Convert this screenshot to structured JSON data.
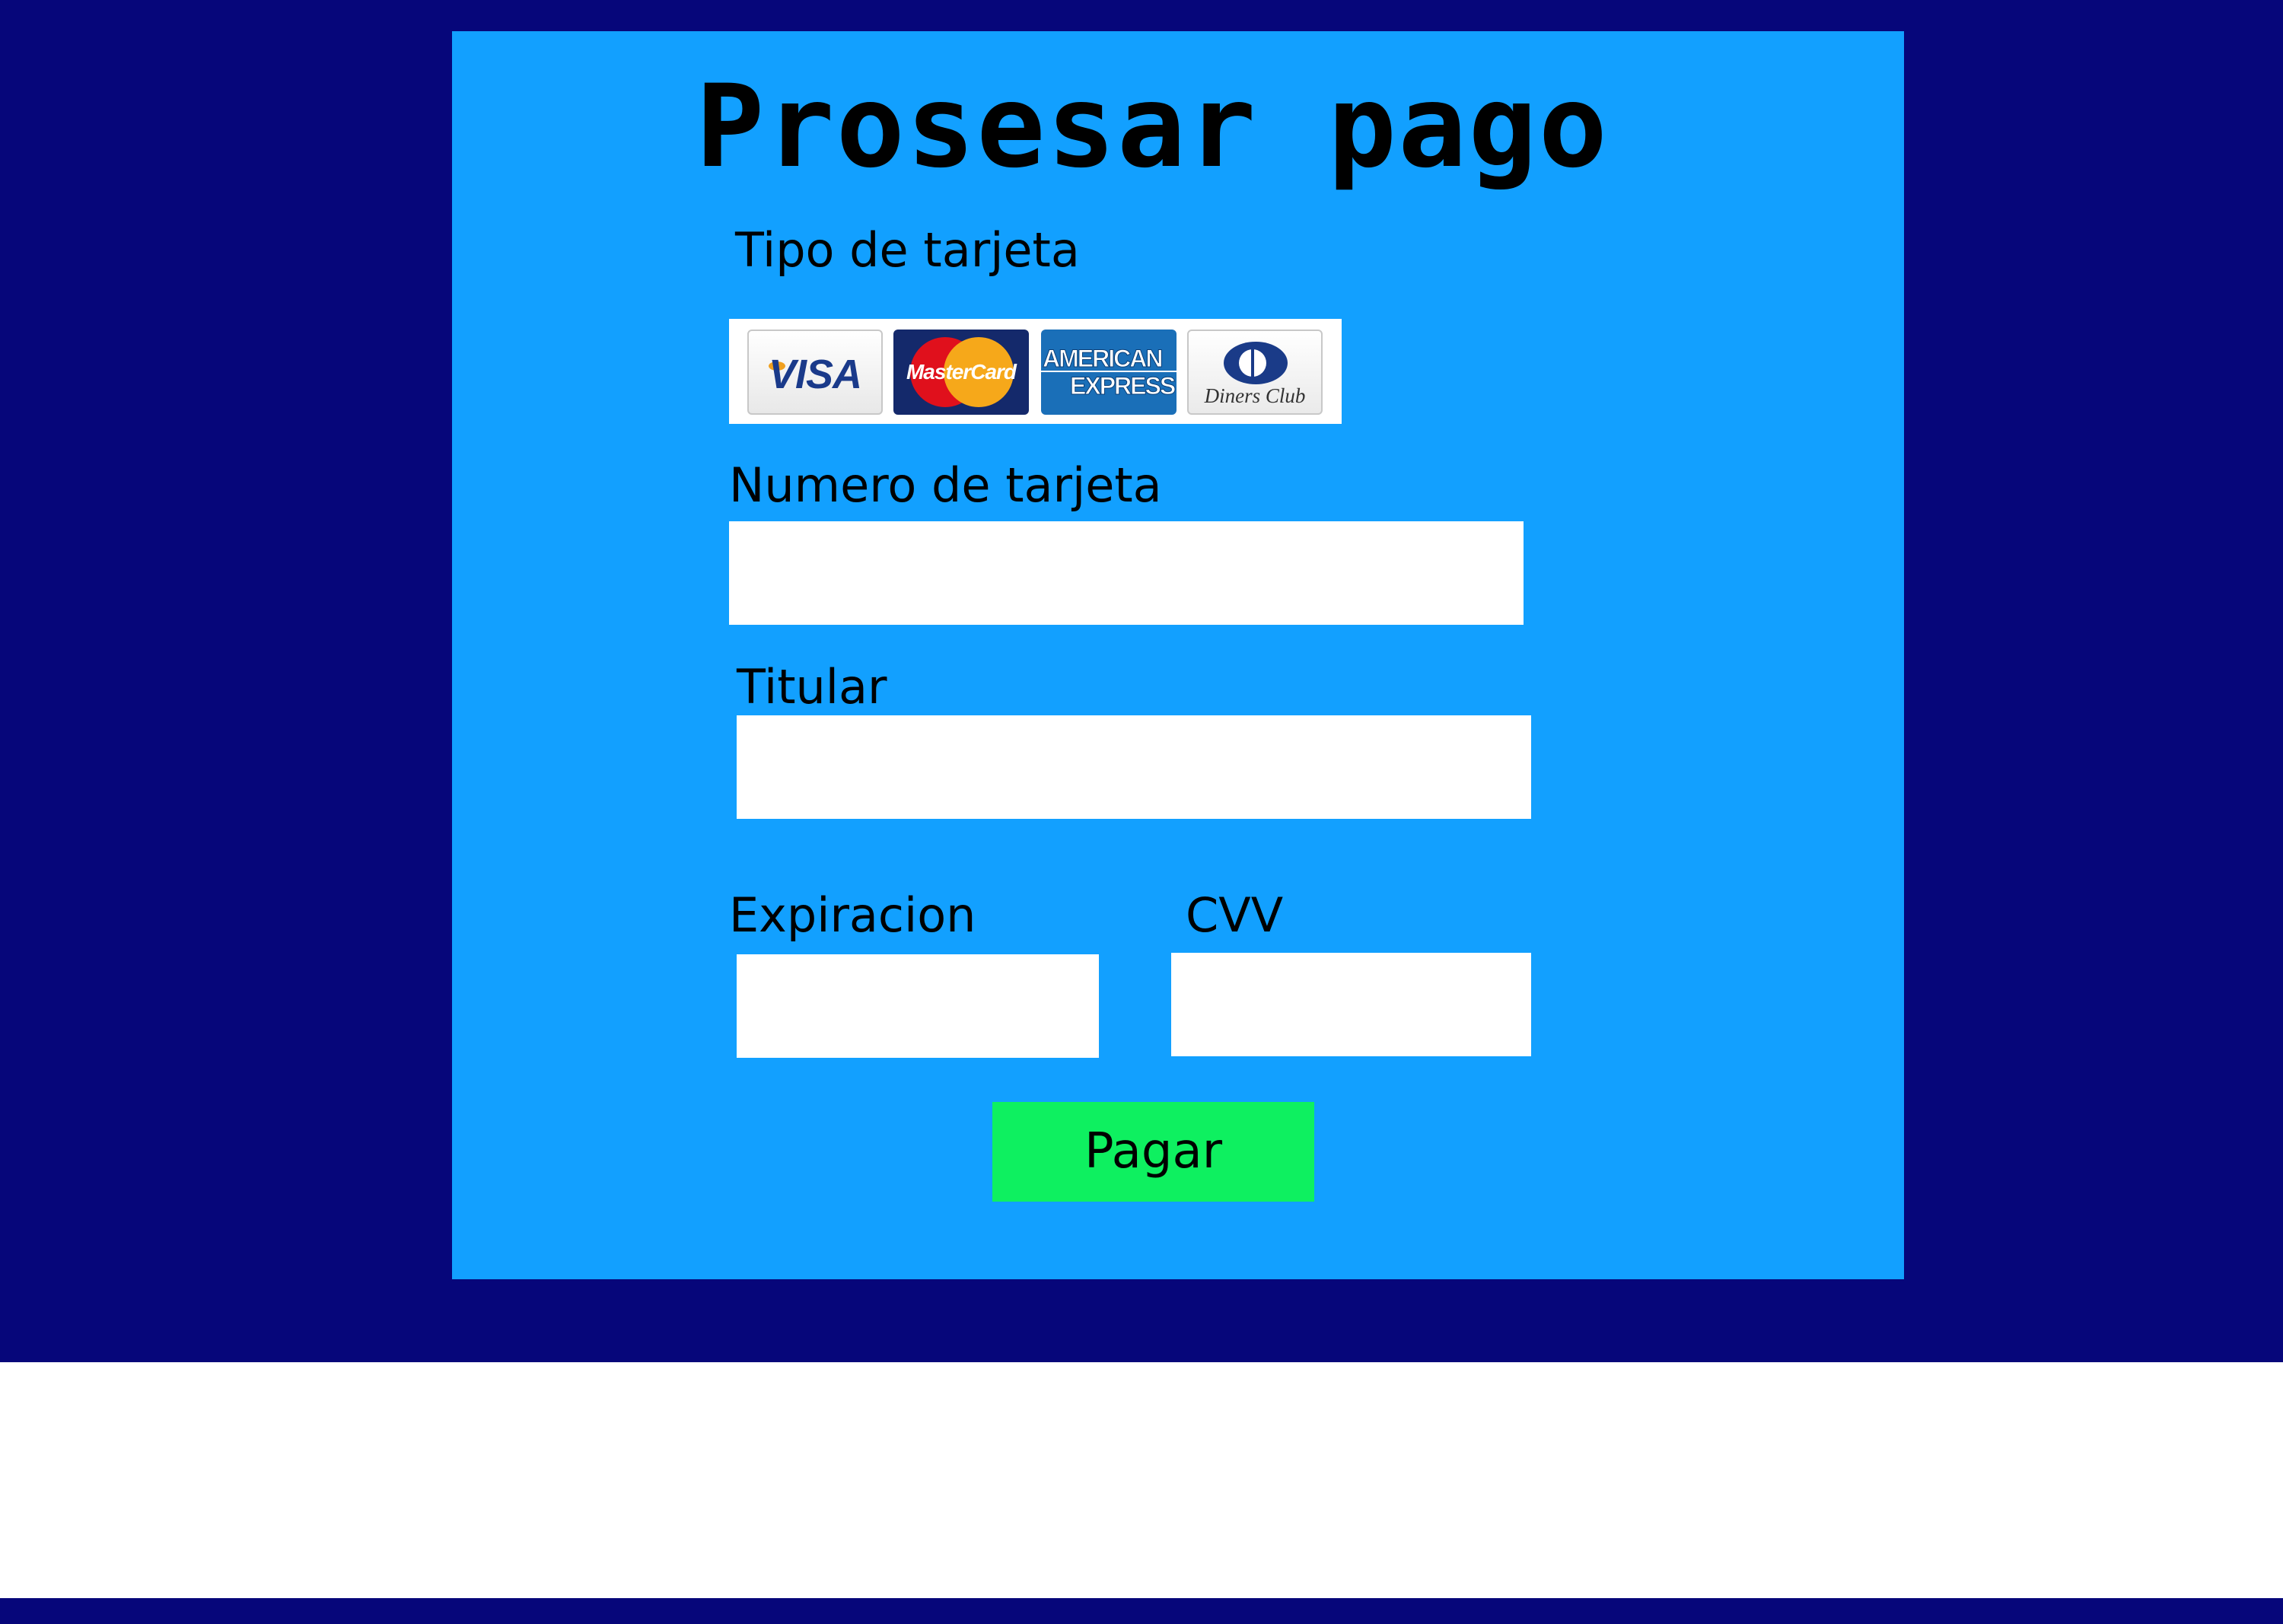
{
  "page": {
    "title": "Prosesar pago"
  },
  "form": {
    "card_type_label": "Tipo de tarjeta",
    "cards": [
      {
        "name": "VISA"
      },
      {
        "name": "MasterCard"
      },
      {
        "name_line1": "AMERICAN",
        "name_line2": "EXPRESS"
      },
      {
        "name": "Diners Club"
      }
    ],
    "card_number_label": "Numero de tarjeta",
    "card_number_value": "",
    "holder_label": "Titular",
    "holder_value": "",
    "expiration_label": "Expiracion",
    "expiration_value": "",
    "cvv_label": "CVV",
    "cvv_value": "",
    "submit_label": "Pagar"
  },
  "colors": {
    "outer_background": "#06067a",
    "panel_background": "#12a0ff",
    "input_background": "#ffffff",
    "button_background": "#0ef060"
  }
}
